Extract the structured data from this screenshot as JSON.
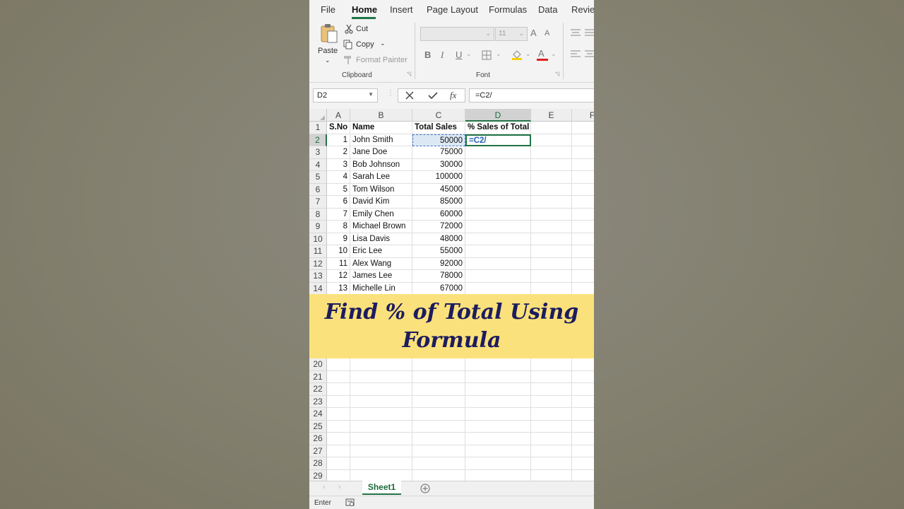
{
  "ribbon": {
    "tabs": [
      "File",
      "Home",
      "Insert",
      "Page Layout",
      "Formulas",
      "Data",
      "Review"
    ],
    "active_tab": "Home",
    "clipboard": {
      "paste_label": "Paste",
      "cut_label": "Cut",
      "copy_label": "Copy",
      "format_painter_label": "Format Painter",
      "group_label": "Clipboard"
    },
    "font": {
      "font_size": "11",
      "bold_label": "B",
      "italic_label": "I",
      "underline_label": "U",
      "grow_label": "A",
      "shrink_label": "A",
      "color_label": "A",
      "group_label": "Font"
    }
  },
  "formula_bar": {
    "name_box": "D2",
    "formula": "=C2/"
  },
  "sheet": {
    "columns": [
      "A",
      "B",
      "C",
      "D",
      "E",
      "F"
    ],
    "header_row": [
      "S.No",
      "Name",
      "Total Sales",
      "% Sales of Total"
    ],
    "rows": [
      {
        "sno": "1",
        "name": "John Smith",
        "sales": "50000"
      },
      {
        "sno": "2",
        "name": "Jane Doe",
        "sales": "75000"
      },
      {
        "sno": "3",
        "name": "Bob Johnson",
        "sales": "30000"
      },
      {
        "sno": "4",
        "name": "Sarah Lee",
        "sales": "100000"
      },
      {
        "sno": "5",
        "name": "Tom Wilson",
        "sales": "45000"
      },
      {
        "sno": "6",
        "name": "David Kim",
        "sales": "85000"
      },
      {
        "sno": "7",
        "name": "Emily Chen",
        "sales": "60000"
      },
      {
        "sno": "8",
        "name": "Michael Brown",
        "sales": "72000"
      },
      {
        "sno": "9",
        "name": "Lisa Davis",
        "sales": "48000"
      },
      {
        "sno": "10",
        "name": "Eric Lee",
        "sales": "55000"
      },
      {
        "sno": "11",
        "name": "Alex Wang",
        "sales": "92000"
      },
      {
        "sno": "12",
        "name": "James Lee",
        "sales": "78000"
      },
      {
        "sno": "13",
        "name": "Michelle Lin",
        "sales": "67000"
      }
    ],
    "editing_cell_text": "=C2/",
    "row_numbers_top": [
      "1",
      "2",
      "3",
      "4",
      "5",
      "6",
      "7",
      "8",
      "9",
      "10",
      "11",
      "12",
      "13",
      "14"
    ],
    "row_numbers_bottom": [
      "20",
      "21",
      "22",
      "23",
      "24",
      "25",
      "26",
      "27",
      "28",
      "29"
    ]
  },
  "banner": {
    "line1": "Find % of Total Using",
    "line2": "Formula"
  },
  "sheet_tabs": {
    "active": "Sheet1"
  },
  "status": {
    "mode": "Enter"
  },
  "colors": {
    "accent": "#217346",
    "banner_bg": "#fbe17b",
    "banner_text": "#1c1c5e",
    "formula_ref": "#1f5fb5"
  }
}
